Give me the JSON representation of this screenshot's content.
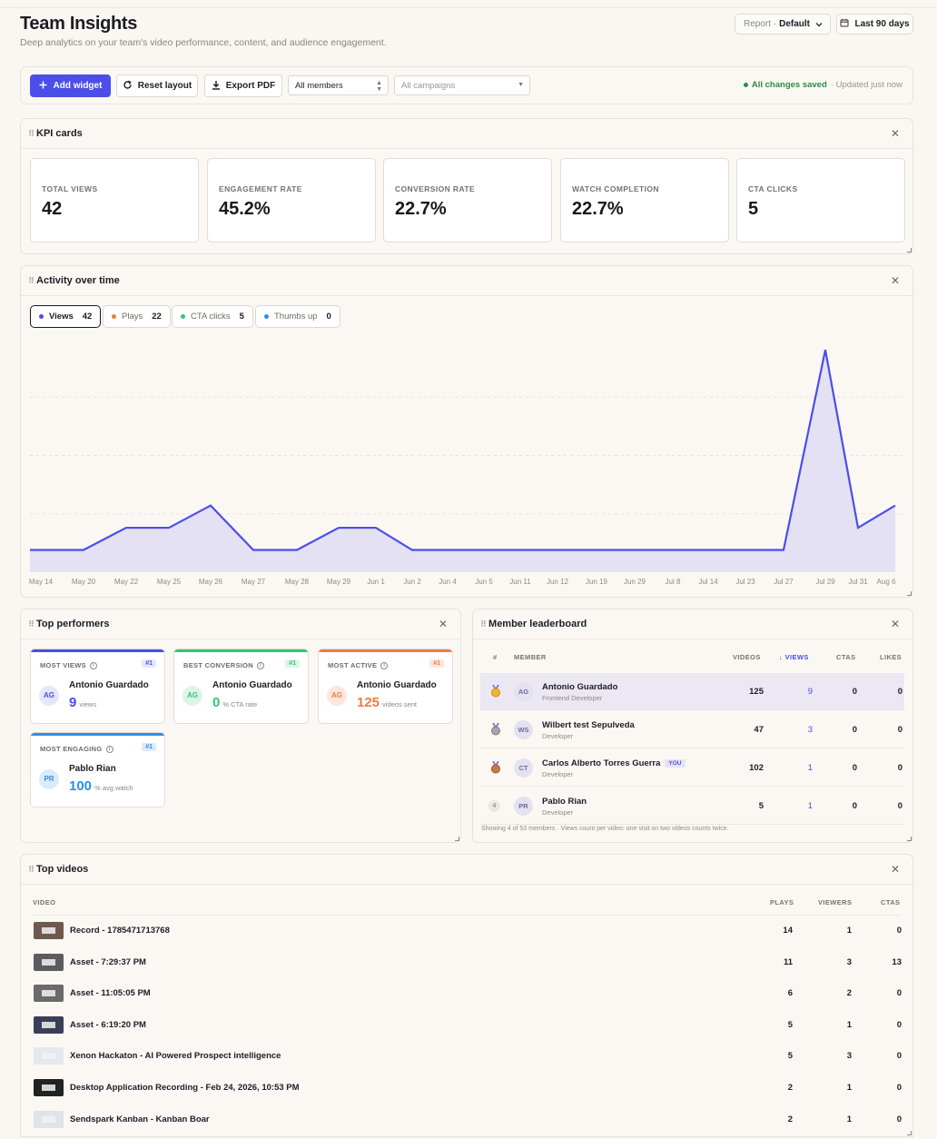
{
  "page": {
    "title": "Team Insights",
    "subtitle": "Deep analytics on your team's video performance, content, and audience engagement.",
    "report_label": "Report ·",
    "report_value": "Default",
    "date_range": "Last 90 days"
  },
  "toolbar": {
    "add_widget": "Add widget",
    "reset_layout": "Reset layout",
    "export_pdf": "Export PDF",
    "members_select": "All members",
    "campaigns_placeholder": "All campaigns",
    "saved_status": "All changes saved",
    "updated_text": "· Updated just now"
  },
  "kpi": {
    "title": "KPI cards",
    "cards": [
      {
        "label": "TOTAL VIEWS",
        "value": "42"
      },
      {
        "label": "ENGAGEMENT RATE",
        "value": "45.2%"
      },
      {
        "label": "CONVERSION RATE",
        "value": "22.7%"
      },
      {
        "label": "WATCH COMPLETION",
        "value": "22.7%"
      },
      {
        "label": "CTA CLICKS",
        "value": "5"
      }
    ]
  },
  "activity": {
    "title": "Activity over time",
    "pills": [
      {
        "label": "Views",
        "count": "42",
        "color": "#4b4ee8",
        "active": true
      },
      {
        "label": "Plays",
        "count": "22",
        "color": "#f07a45",
        "active": false
      },
      {
        "label": "CTA clicks",
        "count": "5",
        "color": "#2fc774",
        "active": false
      },
      {
        "label": "Thumbs up",
        "count": "0",
        "color": "#2f8fe8",
        "active": false
      }
    ]
  },
  "chart_data": {
    "type": "area",
    "x": [
      "May 14",
      "May 20",
      "May 22",
      "May 25",
      "May 26",
      "May 27",
      "May 28",
      "May 29",
      "Jun 1",
      "Jun 2",
      "Jun 4",
      "Jun 5",
      "Jun 11",
      "Jun 12",
      "Jun 19",
      "Jun 29",
      "Jul 8",
      "Jul 14",
      "Jul 23",
      "Jul 27",
      "Jul 29",
      "Jul 31",
      "Aug 6"
    ],
    "series": [
      {
        "name": "Views",
        "color": "#4b4ee8",
        "values": [
          1,
          1,
          2,
          2,
          3,
          1,
          1,
          2,
          2,
          1,
          1,
          1,
          1,
          1,
          1,
          1,
          1,
          1,
          1,
          1,
          10,
          2,
          3
        ]
      }
    ],
    "ylim": [
      0,
      10.5
    ],
    "grid": true,
    "xlabel": "",
    "ylabel": ""
  },
  "performers": {
    "title": "Top performers",
    "cards": [
      {
        "label": "MOST VIEWS",
        "rank": "#1",
        "initials": "AG",
        "name": "Antonio Guardado",
        "value": "9",
        "unit": "views",
        "color": "#4b4ee8",
        "rank_bg": "#e6e6fb"
      },
      {
        "label": "BEST CONVERSION",
        "rank": "#1",
        "initials": "AG",
        "name": "Antonio Guardado",
        "value": "0",
        "unit": "% CTA rate",
        "color": "#2fc774",
        "rank_bg": "#dcf6e6"
      },
      {
        "label": "MOST ACTIVE",
        "rank": "#1",
        "initials": "AG",
        "name": "Antonio Guardado",
        "value": "125",
        "unit": "videos sent",
        "color": "#f07a45",
        "rank_bg": "#fde6dc"
      },
      {
        "label": "MOST ENGAGING",
        "rank": "#1",
        "initials": "PR",
        "name": "Pablo Rian",
        "value": "100",
        "unit": "% avg watch",
        "color": "#2f8fe8",
        "rank_bg": "#dceafc"
      }
    ]
  },
  "leaderboard": {
    "title": "Member leaderboard",
    "headers": {
      "rank": "#",
      "member": "MEMBER",
      "videos": "VIDEOS",
      "views": "↓ VIEWS",
      "ctas": "CTAS",
      "likes": "LIKES"
    },
    "rows": [
      {
        "rank": "1",
        "initials": "AG",
        "name": "Antonio Guardado",
        "role": "Frontend Developer",
        "videos": "125",
        "views": "9",
        "ctas": "0",
        "likes": "0",
        "medal": "gold",
        "you": ""
      },
      {
        "rank": "2",
        "initials": "WS",
        "name": "Wilbert test Sepulveda",
        "role": "Developer",
        "videos": "47",
        "views": "3",
        "ctas": "0",
        "likes": "0",
        "medal": "silver",
        "you": ""
      },
      {
        "rank": "3",
        "initials": "CT",
        "name": "Carlos Alberto Torres Guerra",
        "role": "Developer",
        "videos": "102",
        "views": "1",
        "ctas": "0",
        "likes": "0",
        "medal": "bronze",
        "you": "YOU"
      },
      {
        "rank": "4",
        "initials": "PR",
        "name": "Pablo Rian",
        "role": "Developer",
        "videos": "5",
        "views": "1",
        "ctas": "0",
        "likes": "0",
        "medal": "",
        "you": ""
      }
    ],
    "footer": "Showing 4 of 53 members · Views count per video: one visit on two videos counts twice."
  },
  "top_videos": {
    "title": "Top videos",
    "headers": {
      "video": "VIDEO",
      "plays": "PLAYS",
      "viewers": "VIEWERS",
      "ctas": "CTAS"
    },
    "rows": [
      {
        "name": "Record - 1785471713768",
        "plays": "14",
        "viewers": "1",
        "ctas": "0",
        "thumb": "#6d5a4c"
      },
      {
        "name": "Asset - 7:29:37 PM",
        "plays": "11",
        "viewers": "3",
        "ctas": "13",
        "thumb": "#5c5c5c"
      },
      {
        "name": "Asset - 11:05:05 PM",
        "plays": "6",
        "viewers": "2",
        "ctas": "0",
        "thumb": "#6a6a6a"
      },
      {
        "name": "Asset - 6:19:20 PM",
        "plays": "5",
        "viewers": "1",
        "ctas": "0",
        "thumb": "#3a3f57"
      },
      {
        "name": "Xenon Hackaton - AI Powered Prospect intelligence",
        "plays": "5",
        "viewers": "3",
        "ctas": "0",
        "thumb": "#e4e8ef"
      },
      {
        "name": "Desktop Application Recording - Feb 24, 2026, 10:53 PM",
        "plays": "2",
        "viewers": "1",
        "ctas": "0",
        "thumb": "#222222"
      },
      {
        "name": "Sendspark Kanban - Kanban Boar",
        "plays": "2",
        "viewers": "1",
        "ctas": "0",
        "thumb": "#dfe3ea"
      }
    ]
  }
}
